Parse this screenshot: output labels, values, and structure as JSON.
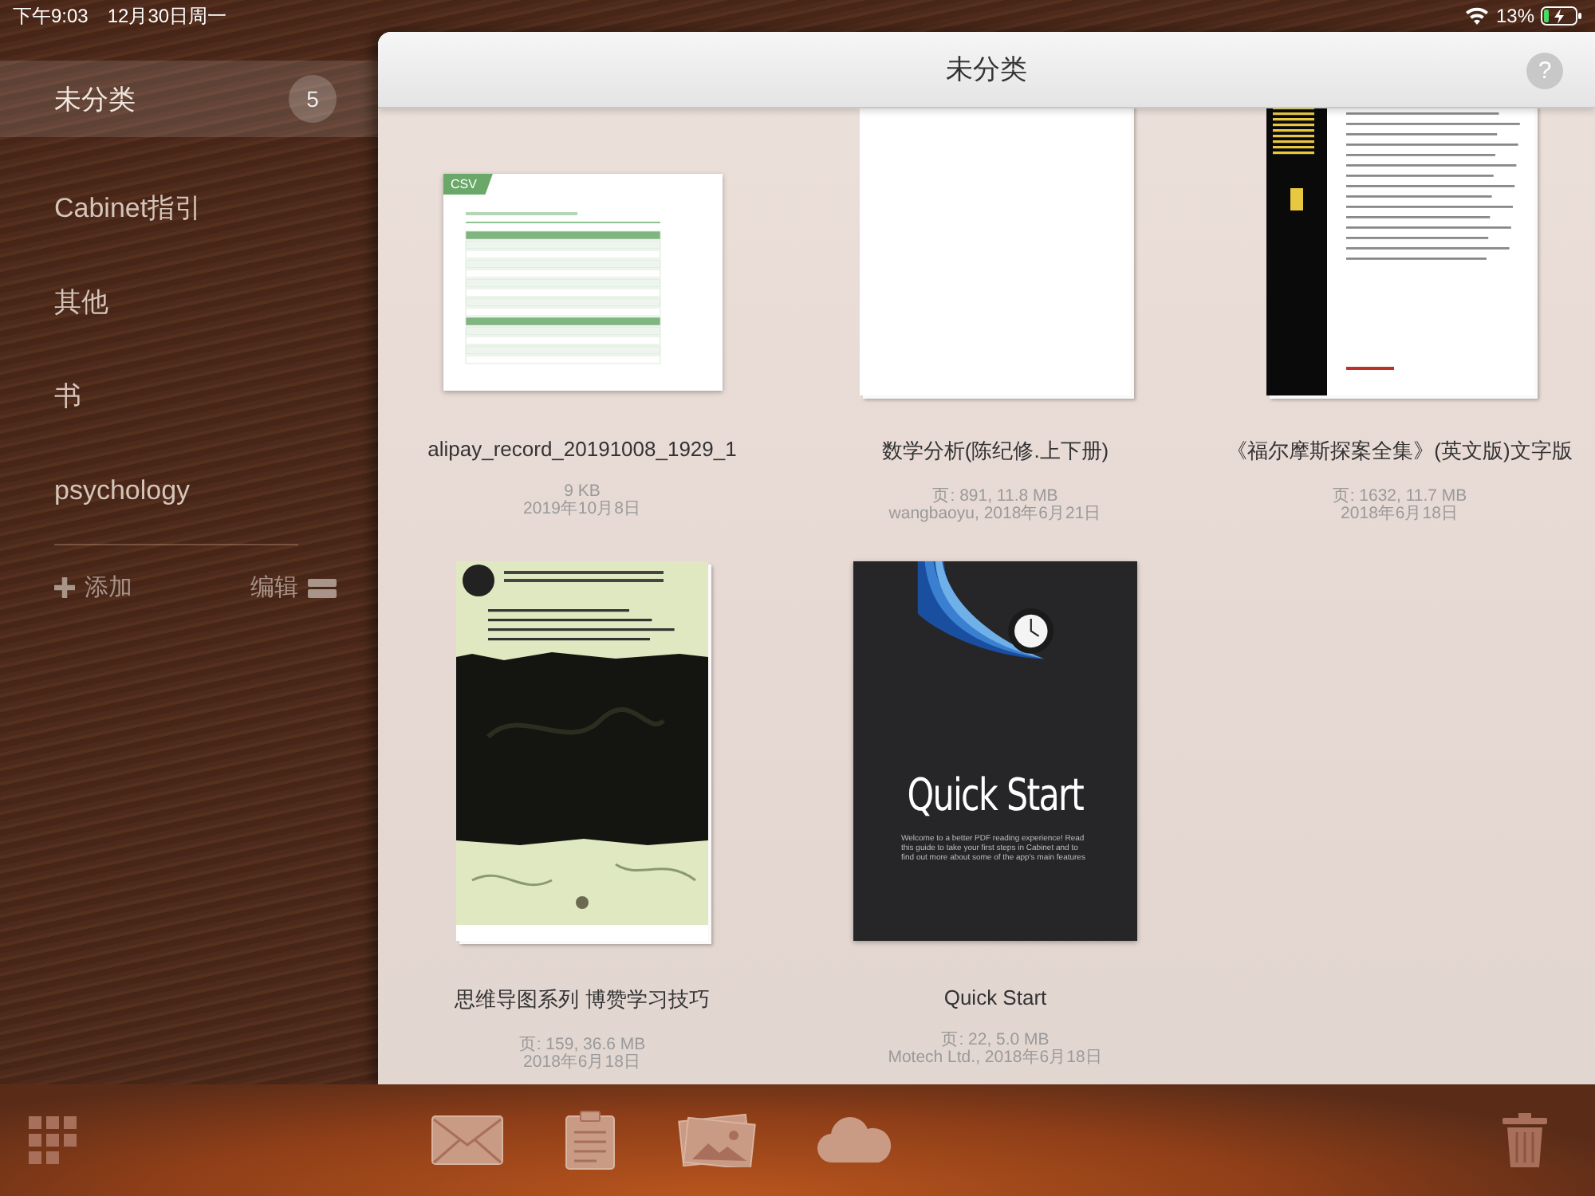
{
  "status_bar": {
    "time": "下午9:03",
    "date": "12月30日周一",
    "battery": "13%"
  },
  "sidebar": {
    "items": [
      {
        "label": "未分类",
        "count": "5",
        "selected": true
      },
      {
        "label": "Cabinet指引",
        "selected": false
      },
      {
        "label": "其他",
        "selected": false
      },
      {
        "label": "书",
        "selected": false
      },
      {
        "label": "psychology",
        "selected": false
      }
    ],
    "add_label": "添加",
    "edit_label": "编辑"
  },
  "panel": {
    "title": "未分类",
    "help": "?"
  },
  "documents": [
    {
      "kind": "csv",
      "tag": "CSV",
      "name": "alipay_record_20191008_1929_1",
      "meta": [
        "9 KB",
        "2019年10月8日"
      ]
    },
    {
      "kind": "text",
      "name": "数学分析(陈纪修.上下册)",
      "meta": [
        "页: 891, 11.8 MB",
        "wangbaoyu, 2018年6月21日"
      ]
    },
    {
      "kind": "toc",
      "name": "《福尔摩斯探案全集》(英文版)文字版",
      "meta": [
        "页: 1632, 11.7 MB",
        "2018年6月18日"
      ]
    },
    {
      "kind": "book",
      "name": "思维导图系列 博赞学习技巧",
      "meta": [
        "页: 159, 36.6 MB",
        "2018年6月18日"
      ]
    },
    {
      "kind": "cover",
      "cover_title": "Quick Start",
      "cover_text": "Welcome to a better PDF reading experience! Read this guide to take your first steps in Cabinet and to find out more about some of the app's main features",
      "name": "Quick Start",
      "meta": [
        "页: 22, 5.0 MB",
        "Motech Ltd., 2018年6月18日"
      ]
    }
  ]
}
